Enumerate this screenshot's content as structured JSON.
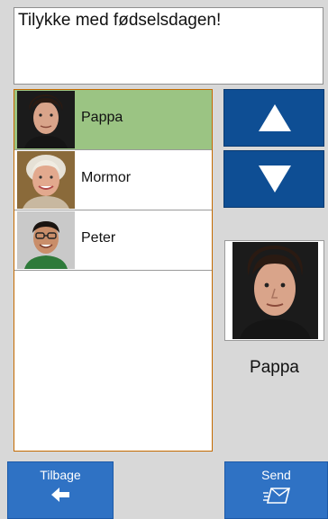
{
  "message": {
    "text": "Tilykke med fødselsdagen!"
  },
  "contacts": [
    {
      "name": "Pappa",
      "selected": true,
      "photo": "man-portrait"
    },
    {
      "name": "Mormor",
      "selected": false,
      "photo": "grandmother-portrait"
    },
    {
      "name": "Peter",
      "selected": false,
      "photo": "boy-portrait"
    }
  ],
  "navigation": {
    "up_icon": "arrow-up-icon",
    "down_icon": "arrow-down-icon"
  },
  "preview": {
    "name": "Pappa",
    "photo": "man-portrait"
  },
  "buttons": {
    "back_label": "Tilbage",
    "back_icon": "arrow-left-icon",
    "send_label": "Send",
    "send_icon": "send-envelope-icon"
  },
  "colors": {
    "selected_row": "#9bc483",
    "nav_button": "#0e4e94",
    "action_button": "#2f72c4",
    "list_border": "#c46a00"
  }
}
